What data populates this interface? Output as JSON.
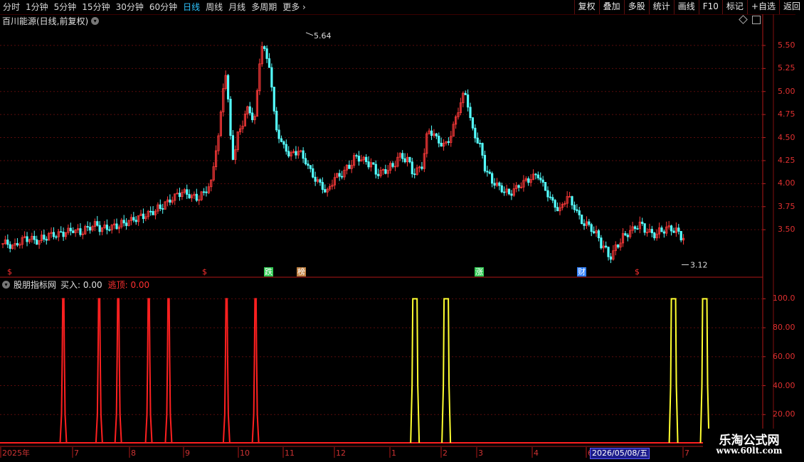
{
  "toolbar": {
    "tabs": [
      "分时",
      "1分钟",
      "5分钟",
      "15分钟",
      "30分钟",
      "60分钟",
      "日线",
      "周线",
      "月线",
      "多周期",
      "更多"
    ],
    "active_tab": "日线",
    "more_arrow": "›",
    "right_buttons": [
      "复权",
      "叠加",
      "多股",
      "统计",
      "画线",
      "F10",
      "标记",
      "+自选",
      "返回"
    ]
  },
  "stock": {
    "title": "百川能源(日线,前复权)"
  },
  "price_axis": {
    "ticks": [
      "5.50",
      "5.25",
      "5.00",
      "4.75",
      "4.50",
      "4.25",
      "4.00",
      "3.75",
      "3.50"
    ]
  },
  "annotations": {
    "high_label": "5.64",
    "low_label": "3.12",
    "markers": [
      "$",
      "$",
      "跌",
      "榜",
      "涨",
      "财",
      "$"
    ]
  },
  "indicator": {
    "name": "股朋指标网",
    "buy_text": "买入: 0.00",
    "sell_text": "逃顶: 0.00",
    "axis_ticks": [
      "100.0",
      "80.00",
      "60.00",
      "40.00",
      "20.00"
    ]
  },
  "time_axis": {
    "labels": [
      "2025年",
      "7",
      "8",
      "9",
      "10",
      "11",
      "12",
      "1",
      "2",
      "3",
      "4",
      "6",
      "7"
    ],
    "cursor_date": "2026/05/08/五"
  },
  "watermark": {
    "line1": "乐淘公式网",
    "line2": "www.60lt.com"
  },
  "colors": {
    "up": "#ff3a3a",
    "down": "#54ffff",
    "signal_sell": "#ff2020",
    "signal_buy": "#ffff30",
    "grid": "#5a0c0c"
  },
  "chart_data": [
    {
      "type": "candlestick",
      "title": "百川能源(日线,前复权)",
      "ylim": [
        3.0,
        5.7
      ],
      "x_start": "2025-06",
      "high": 5.64,
      "low": 3.12,
      "close_approx": [
        3.35,
        3.32,
        3.38,
        3.4,
        3.38,
        3.42,
        3.45,
        3.44,
        3.46,
        3.5,
        3.48,
        3.52,
        3.55,
        3.5,
        3.52,
        3.55,
        3.58,
        3.6,
        3.62,
        3.65,
        3.7,
        3.75,
        3.8,
        3.85,
        3.9,
        3.88,
        3.85,
        3.9,
        4.0,
        4.5,
        5.2,
        4.3,
        4.6,
        4.8,
        4.7,
        5.5,
        5.3,
        4.6,
        4.4,
        4.3,
        4.35,
        4.25,
        4.1,
        4.0,
        3.9,
        4.05,
        4.1,
        4.2,
        4.3,
        4.25,
        4.2,
        4.1,
        4.15,
        4.2,
        4.3,
        4.25,
        4.1,
        4.2,
        4.6,
        4.5,
        4.4,
        4.5,
        4.8,
        5.0,
        4.6,
        4.4,
        4.1,
        4.0,
        3.95,
        3.9,
        3.95,
        4.0,
        4.05,
        4.1,
        3.95,
        3.8,
        3.7,
        3.85,
        3.75,
        3.6,
        3.55,
        3.45,
        3.3,
        3.2,
        3.35,
        3.45,
        3.5,
        3.55,
        3.48,
        3.45,
        3.5,
        3.52,
        3.48,
        3.4
      ]
    },
    {
      "type": "line",
      "title": "股朋指标网",
      "ylim": [
        0,
        110
      ],
      "series": [
        {
          "name": "买入",
          "values": [
            0.0
          ],
          "spikes_at_fraction": [
            0.544,
            0.585,
            0.883,
            0.924
          ],
          "spike_value": 100.0
        },
        {
          "name": "逃顶",
          "values": [
            0.0
          ],
          "spikes_at_fraction": [
            0.083,
            0.13,
            0.155,
            0.195,
            0.221,
            0.297,
            0.335
          ],
          "spike_value": 100.0
        }
      ]
    }
  ]
}
